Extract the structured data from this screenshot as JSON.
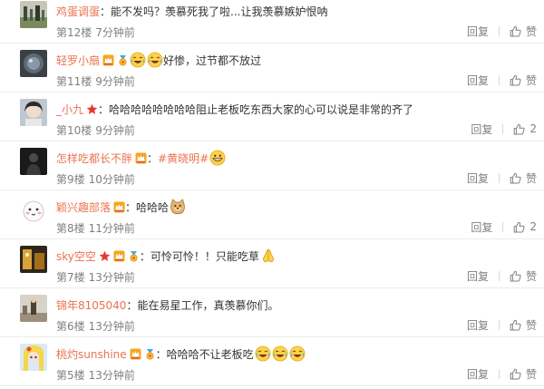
{
  "labels": {
    "reply": "回复",
    "like": "赞"
  },
  "colors": {
    "username": "#eb7350",
    "meta": "#808080",
    "text": "#333333",
    "divider": "#ececec"
  },
  "comments": [
    {
      "username": "鸡蛋调蛋",
      "badges": [],
      "colon": "：",
      "content": "能不发吗？羡慕死我了啦...让我羡慕嫉妒恨呐",
      "topic": "",
      "emojis": [],
      "content_after": "",
      "floor": "第12楼",
      "time": "7分钟前",
      "like_count": ""
    },
    {
      "username": "轻罗小扇",
      "badges": [
        "vip-crown-badge",
        "medal-badge"
      ],
      "colon": "",
      "content": "",
      "topic": "",
      "emojis": [
        "laugh-cry-emoji",
        "laugh-cry-emoji"
      ],
      "content_after": "好惨，过节都不放过",
      "floor": "第11楼",
      "time": "9分钟前",
      "like_count": ""
    },
    {
      "username": "_小九",
      "badges": [
        "star-badge"
      ],
      "colon": "：",
      "content": "哈哈哈哈哈哈哈哈阻止老板吃东西大家的心可以说是非常的齐了",
      "topic": "",
      "emojis": [],
      "content_after": "",
      "floor": "第10楼",
      "time": "9分钟前",
      "like_count": "2"
    },
    {
      "username": "怎样吃都长不胖",
      "badges": [
        "vip-crown-badge"
      ],
      "colon": "：",
      "content": "",
      "topic": "#黄晓明#",
      "emojis": [
        "grin-emoji"
      ],
      "content_after": "",
      "floor": "第9楼",
      "time": "10分钟前",
      "like_count": ""
    },
    {
      "username": "颖兴趣部落",
      "badges": [
        "vip-crown-badge"
      ],
      "colon": "：",
      "content": "哈哈哈",
      "topic": "",
      "emojis": [
        "doge-emoji"
      ],
      "content_after": "",
      "floor": "第8楼",
      "time": "11分钟前",
      "like_count": "2"
    },
    {
      "username": "sky空空",
      "badges": [
        "star-badge",
        "vip-crown-badge",
        "medal-badge"
      ],
      "colon": "：",
      "content": "可怜可怜！！只能吃草",
      "topic": "",
      "emojis": [
        "pray-emoji"
      ],
      "content_after": "",
      "floor": "第7楼",
      "time": "13分钟前",
      "like_count": ""
    },
    {
      "username": "锦年8105040",
      "badges": [],
      "colon": "：",
      "content": "能在易星工作，真羡慕你们。",
      "topic": "",
      "emojis": [],
      "content_after": "",
      "floor": "第6楼",
      "time": "13分钟前",
      "like_count": ""
    },
    {
      "username": "桃灼sunshine",
      "badges": [
        "vip-crown-badge",
        "medal-badge"
      ],
      "colon": "：",
      "content": "哈哈哈不让老板吃",
      "topic": "",
      "emojis": [
        "laugh-cry-emoji",
        "laugh-cry-emoji",
        "laugh-cry-emoji"
      ],
      "content_after": "",
      "floor": "第5楼",
      "time": "13分钟前",
      "like_count": ""
    }
  ]
}
